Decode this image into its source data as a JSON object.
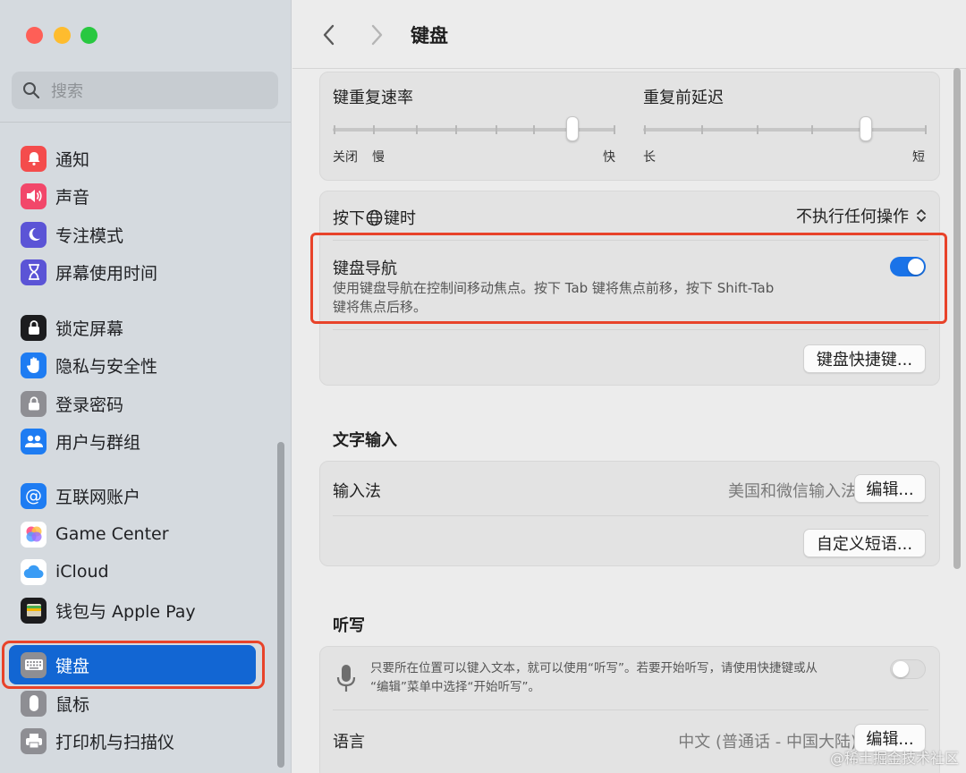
{
  "sidebar": {
    "search_placeholder": "搜索",
    "groups": [
      [
        {
          "label": "通知",
          "icon": "bell-icon",
          "color": "#f44c4c"
        },
        {
          "label": "声音",
          "icon": "speaker-icon",
          "color": "#f2476a"
        },
        {
          "label": "专注模式",
          "icon": "moon-icon",
          "color": "#5b54d6"
        },
        {
          "label": "屏幕使用时间",
          "icon": "hourglass-icon",
          "color": "#5b54d6"
        }
      ],
      [
        {
          "label": "锁定屏幕",
          "icon": "lock-screen-icon",
          "color": "#1c1c1e"
        },
        {
          "label": "隐私与安全性",
          "icon": "hand-icon",
          "color": "#1e7cf2"
        },
        {
          "label": "登录密码",
          "icon": "lock-icon",
          "color": "#8e8e93"
        },
        {
          "label": "用户与群组",
          "icon": "users-icon",
          "color": "#1e7cf2"
        }
      ],
      [
        {
          "label": "互联网账户",
          "icon": "at-icon",
          "color": "#1e7cf2"
        },
        {
          "label": "Game Center",
          "icon": "game-center-icon",
          "color": "#ffffff"
        },
        {
          "label": "iCloud",
          "icon": "cloud-icon",
          "color": "#ffffff"
        },
        {
          "label": "钱包与 Apple Pay",
          "icon": "wallet-icon",
          "color": "#1c1c1e"
        }
      ],
      [
        {
          "label": "键盘",
          "icon": "keyboard-icon",
          "color": "#8e8e93",
          "active": true
        },
        {
          "label": "鼠标",
          "icon": "mouse-icon",
          "color": "#8e8e93"
        },
        {
          "label": "打印机与扫描仪",
          "icon": "printer-icon",
          "color": "#8e8e93"
        }
      ]
    ]
  },
  "header": {
    "title": "键盘"
  },
  "keyboard": {
    "repeat_rate": {
      "label": "键重复速率",
      "min_label": "关闭",
      "slow_label": "慢",
      "max_label": "快",
      "value": 0.85
    },
    "repeat_delay": {
      "label": "重复前延迟",
      "min_label": "长",
      "max_label": "短",
      "value": 0.79
    },
    "globe_key": {
      "label_prefix": "按下",
      "label_suffix": "键时",
      "value": "不执行任何操作"
    },
    "keyboard_nav": {
      "label": "键盘导航",
      "desc_line1": "使用键盘导航在控制间移动焦点。按下 Tab 键将焦点前移，按下 Shift-Tab",
      "desc_line2": "键将焦点后移。",
      "enabled": true
    },
    "shortcuts_button": "键盘快捷键..."
  },
  "text_input": {
    "section_title": "文字输入",
    "input_method_label": "输入法",
    "input_method_value": "美国和微信输入法",
    "edit_button": "编辑...",
    "custom_phrase_button": "自定义短语..."
  },
  "dictation": {
    "section_title": "听写",
    "desc_line1": "只要所在位置可以键入文本，就可以使用“听写”。若要开始听写，请使用快捷键或从",
    "desc_line2": "“编辑”菜单中选择“开始听写”。",
    "enabled": false,
    "language_label": "语言",
    "language_value": "中文 (普通话 - 中国大陆)",
    "edit_button": "编辑..."
  },
  "watermark": "@稀土掘金技术社区"
}
